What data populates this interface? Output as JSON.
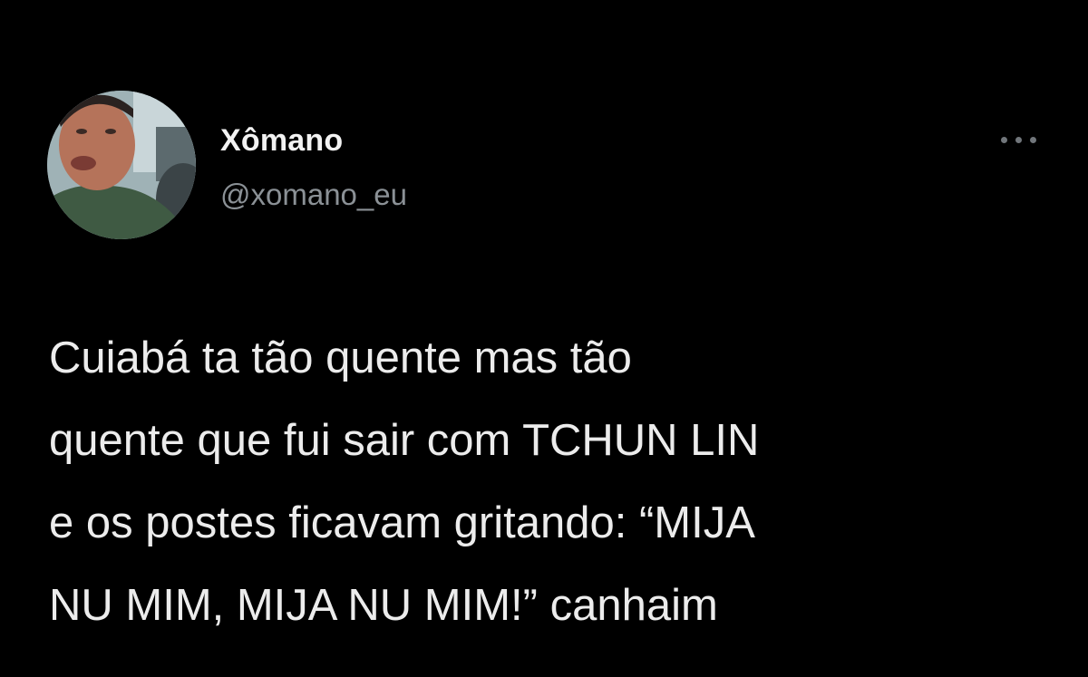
{
  "tweet": {
    "author": {
      "name": "Xômano",
      "handle": "@xomano_eu",
      "avatar_icon": "profile-photo"
    },
    "more_icon": "more-horizontal-icon",
    "text_lines": [
      "Cuiabá ta tão quente mas tão",
      "quente que fui sair com TCHUN LIN",
      "e os postes ficavam gritando: “MIJA",
      "NU MIM, MIJA NU MIM!” canhaim"
    ]
  },
  "colors": {
    "background": "#000000",
    "text": "#e7e9ea",
    "secondary_text": "#8b9196"
  }
}
